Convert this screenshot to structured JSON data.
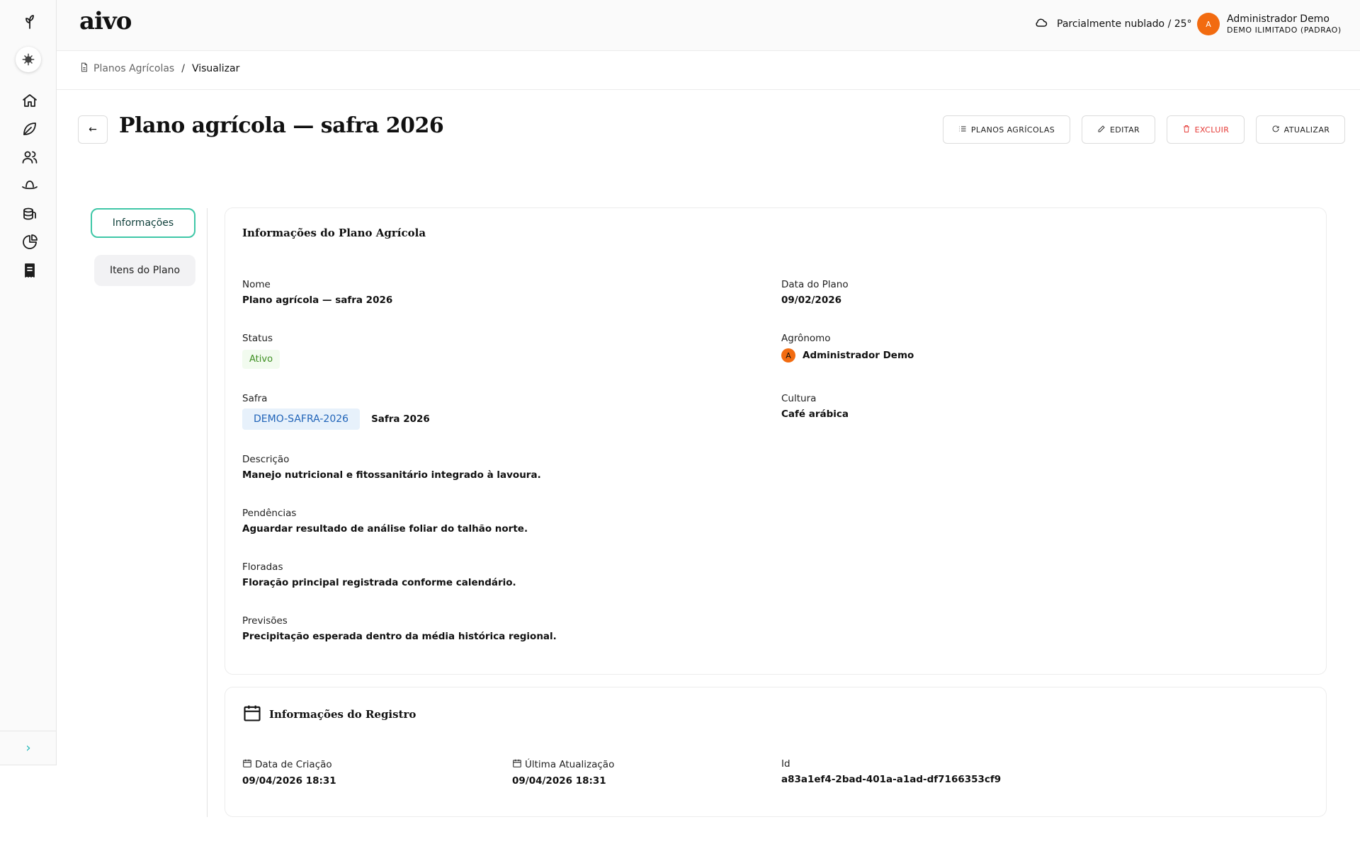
{
  "app": {
    "brand": "aivo"
  },
  "header": {
    "weather_text": "Parcialmente nublado / 25°",
    "user_initial": "A",
    "user_name": "Administrador Demo",
    "user_plan": "DEMO ILIMITADO (PADRAO)"
  },
  "sidebar": {
    "items": [
      {
        "icon": "home-icon"
      },
      {
        "icon": "leaf-icon"
      },
      {
        "icon": "users-icon"
      },
      {
        "icon": "hat-icon"
      },
      {
        "icon": "coins-icon"
      },
      {
        "icon": "pie-chart-icon"
      },
      {
        "icon": "receipt-icon"
      }
    ],
    "expand_glyph": "›"
  },
  "breadcrumb": {
    "parent": "Planos Agrícolas",
    "separator": "/",
    "current": "Visualizar"
  },
  "page": {
    "back_glyph": "←",
    "title": "Plano agrícola — safra 2026",
    "actions": {
      "list": "PLANOS AGRÍCOLAS",
      "edit": "EDITAR",
      "delete": "EXCLUIR",
      "refresh": "ATUALIZAR"
    }
  },
  "tabs": [
    {
      "label": "Informações"
    },
    {
      "label": "Itens do Plano"
    }
  ],
  "plan_card": {
    "title": "Informações do Plano Agrícola",
    "nome_label": "Nome",
    "nome": "Plano agrícola — safra 2026",
    "data_label": "Data do Plano",
    "data": "09/02/2026",
    "status_label": "Status",
    "status": "Ativo",
    "agronomo_label": "Agrônomo",
    "agronomo_initial": "A",
    "agronomo": "Administrador Demo",
    "safra_label": "Safra",
    "safra_code": "DEMO-SAFRA-2026",
    "safra_name": "Safra 2026",
    "cultura_label": "Cultura",
    "cultura": "Café arábica",
    "descricao_label": "Descrição",
    "descricao": "Manejo nutricional e fitossanitário integrado à lavoura.",
    "pendencias_label": "Pendências",
    "pendencias": "Aguardar resultado de análise foliar do talhão norte.",
    "floradas_label": "Floradas",
    "floradas": "Floração principal registrada conforme calendário.",
    "previsoes_label": "Previsões",
    "previsoes": "Precipitação esperada dentro da média histórica regional."
  },
  "record_card": {
    "title": "Informações do Registro",
    "created_label": "Data de Criação",
    "created": "09/04/2026 18:31",
    "updated_label": "Última Atualização",
    "updated": "09/04/2026 18:31",
    "id_label": "Id",
    "id": "a83a1ef4-2bad-401a-a1ad-df7166353cf9"
  },
  "colors": {
    "accent": "#3fc7a7",
    "avatar": "#f26b10",
    "danger": "#e53935",
    "chip": "#1f63b8"
  }
}
